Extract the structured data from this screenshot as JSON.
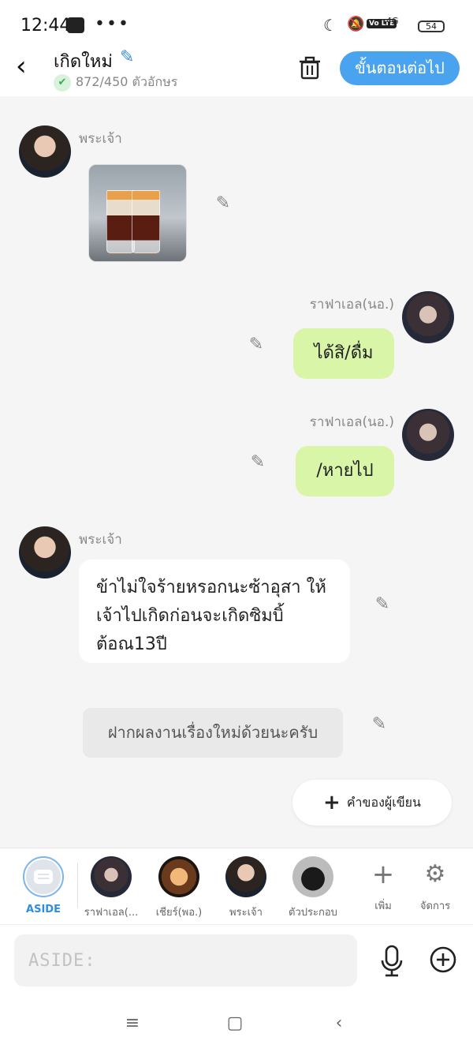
{
  "status_bar": {
    "time": "12:44",
    "overflow": "•••",
    "network": "4G",
    "volte": "Vo LTE",
    "battery": "54"
  },
  "header": {
    "title": "เกิดใหม่",
    "char_count": "872/450 ตัวอักษร",
    "next_button": "ขั้นตอนต่อไป",
    "accent_color": "#4aa3ef"
  },
  "messages": [
    {
      "sender": "พระเจ้า",
      "type": "image",
      "image_desc_icon": "layered-shot-glasses"
    },
    {
      "sender": "ราฟาเอล(นอ.)",
      "type": "text",
      "text": "ได้สิ/ดื่ม"
    },
    {
      "sender": "ราฟาเอล(นอ.)",
      "type": "text",
      "text": "/หายไป"
    },
    {
      "sender": "พระเจ้า",
      "type": "text",
      "text": "ข้าไม่ใจร้ายหรอกนะซ้าอุสา ให้เจ้าไปเกิดก่อนจะเกิดซิมบิ้ ต้อณ13ปี"
    },
    {
      "sender": "",
      "type": "aside",
      "text": "ฝากผลงานเรื่องใหม่ด้วยนะครับ"
    }
  ],
  "writer_button": "คำของผู้เขียน",
  "characters": [
    {
      "label": "ASIDE",
      "selected": true
    },
    {
      "label": "ราฟาเอล(..."
    },
    {
      "label": "เชียร์(พอ.)"
    },
    {
      "label": "พระเจ้า"
    },
    {
      "label": "ตัวประกอบ"
    }
  ],
  "tools": {
    "add": "เพิ่ม",
    "manage": "จัดการ"
  },
  "input": {
    "placeholder": "ASIDE:"
  }
}
